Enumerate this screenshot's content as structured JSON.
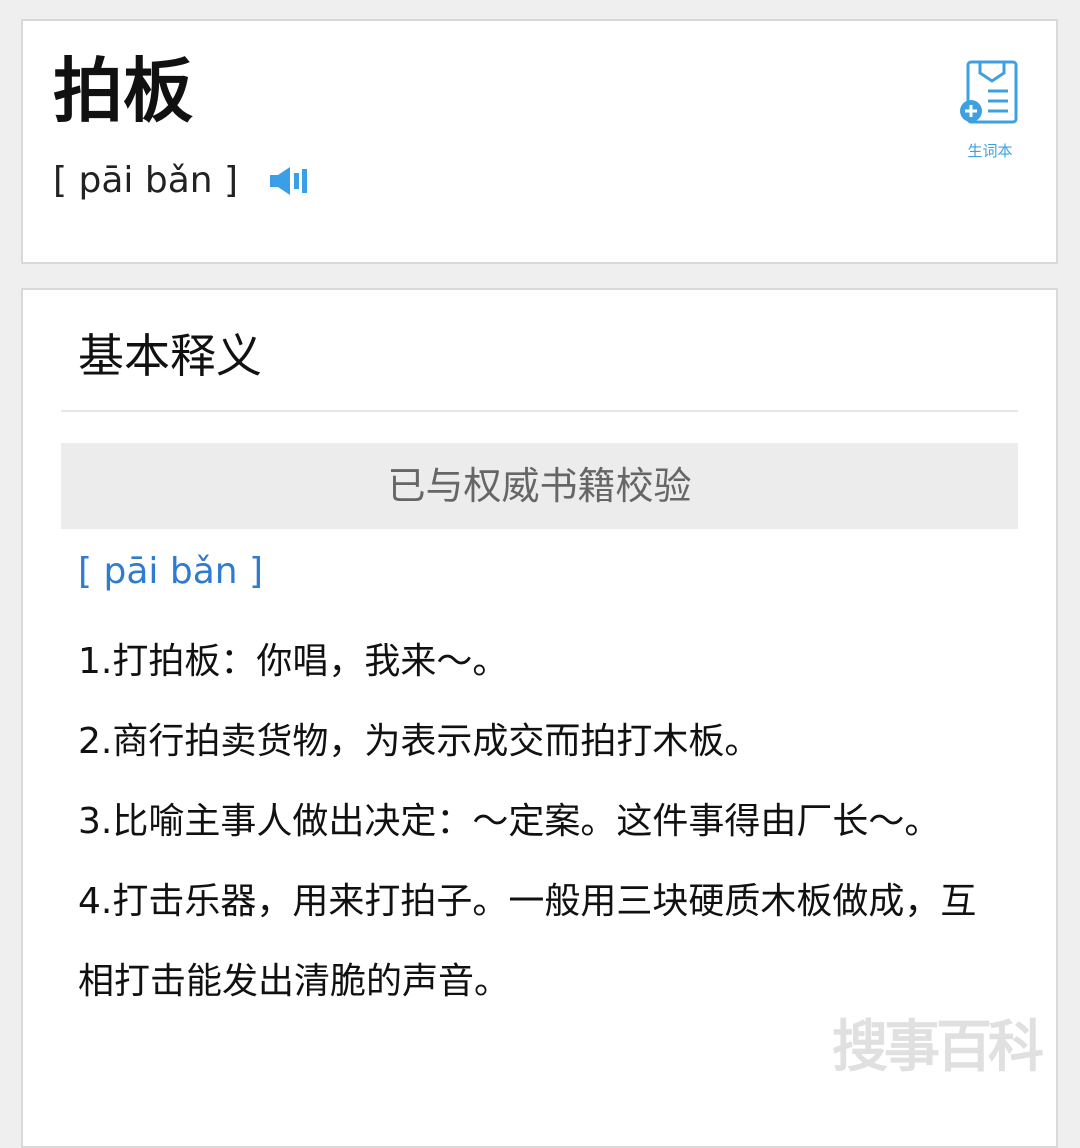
{
  "word": "拍板",
  "pinyin": "[ pāi bǎn ]",
  "vocab_book_label": "生词本",
  "section_title": "基本释义",
  "verified_label": "已与权威书籍校验",
  "definition_pinyin": "[ pāi bǎn ]",
  "definitions": [
    "1.打拍板：你唱，我来～。",
    "2.商行拍卖货物，为表示成交而拍打木板。",
    "3.比喻主事人做出决定：～定案。这件事得由厂长～。",
    "4.打击乐器，用来打拍子。一般用三块硬质木板做成，互相打击能发出清脆的声音。"
  ],
  "watermark": "搜事百科",
  "colors": {
    "accent": "#3fa0e0",
    "pinyin_link": "#2f7bd0",
    "speaker": "#3a9fe6"
  },
  "icons": {
    "speaker": "speaker-icon",
    "vocab_book": "notebook-add-icon"
  }
}
